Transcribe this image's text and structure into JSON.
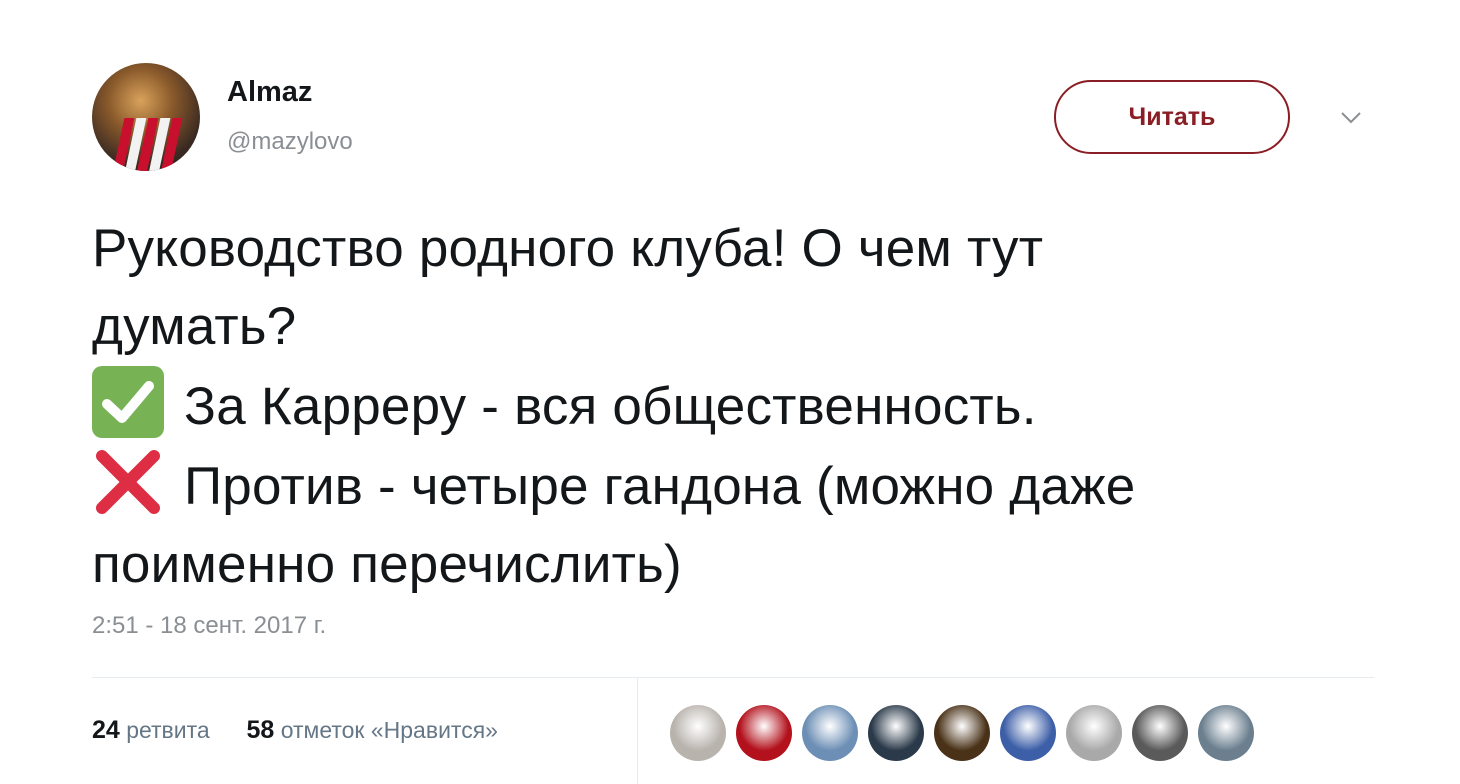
{
  "tweet": {
    "author": {
      "name": "Almaz",
      "handle": "@mazylovo"
    },
    "follow_label": "Читать",
    "text_lines": [
      "Руководство родного клуба! О чем тут",
      "думать?",
      "За Карреру - вся общественность.",
      "Против - четыре гандона (можно даже",
      "поименно перечислить)"
    ],
    "timestamp": "2:51 - 18 сент. 2017 г.",
    "stats": {
      "retweets_count": "24",
      "retweets_label": "ретвита",
      "likes_count": "58",
      "likes_label": "отметок «Нравится»"
    },
    "likers": [
      {
        "color": "#b9b3ad"
      },
      {
        "color": "#b3121d"
      },
      {
        "color": "#6d8fb5"
      },
      {
        "color": "#2b3a4a"
      },
      {
        "color": "#4a3218"
      },
      {
        "color": "#3d5fa8"
      },
      {
        "color": "#a9a9a9"
      },
      {
        "color": "#5a5a5a"
      },
      {
        "color": "#6b7f8f"
      }
    ]
  },
  "colors": {
    "accent": "#8b1e24",
    "text": "#14171a",
    "muted": "#8a8f94",
    "check_green": "#77b255",
    "cross_red": "#dd2e44"
  },
  "icons": {
    "check": "white-heavy-check-mark-icon",
    "cross": "cross-mark-icon",
    "caret": "chevron-down-icon"
  }
}
